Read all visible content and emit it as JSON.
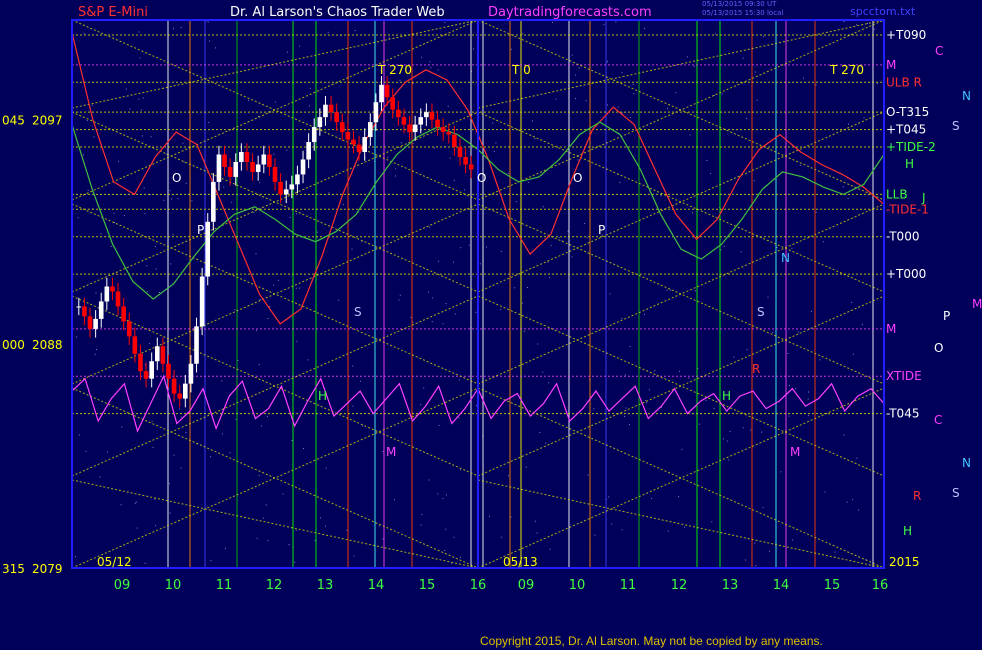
{
  "header": {
    "instrument": "S&P E-Mini",
    "author": "Dr. Al Larson's Chaos Trader Web",
    "site": "Daytradingforecasts.com",
    "timestamp_1": "05/13/2015 09:30 UT",
    "timestamp_2": "05/13/2015 15:30 local",
    "file": "spcctom.txt",
    "copyright": "Copyright 2015, Dr. Al Larson. May not be copied by any means."
  },
  "colors": {
    "background": "#00005a",
    "frame": "#2020ff",
    "price_up": "#ffffff",
    "price_down": "#ff0000",
    "xtide": "#ff40ff",
    "tide": "#40c040",
    "grid_yellow": "#e8e800",
    "axis_label": "#40ff40"
  },
  "chart_data": {
    "type": "line",
    "ylim": [
      2079,
      2101
    ],
    "y_left_labels": [
      {
        "angle": "045",
        "price": "2097",
        "value": 2097
      },
      {
        "angle": "000",
        "price": "2088",
        "value": 2088
      },
      {
        "angle": "315",
        "price": "2079",
        "value": 2079
      }
    ],
    "date_labels": [
      "05/12",
      "05/13"
    ],
    "year_label": "2015",
    "x_ticks": [
      "09",
      "10",
      "11",
      "12",
      "13",
      "14",
      "15",
      "16",
      "09",
      "10",
      "11",
      "12",
      "13",
      "14",
      "15",
      "16"
    ],
    "top_labels": [
      "T  270",
      "T  0",
      "T  270"
    ],
    "right_labels": [
      {
        "text": "+T090",
        "value": 2100.4,
        "color": "#ffffff"
      },
      {
        "text": "M",
        "value": 2099.2,
        "color": "#ff40ff"
      },
      {
        "text": "ULB R",
        "value": 2098.5,
        "color": "#ff3030"
      },
      {
        "text": "O-T315",
        "value": 2097.3,
        "color": "#ffffff"
      },
      {
        "text": "+T045",
        "value": 2096.6,
        "color": "#ffffff"
      },
      {
        "text": "+TIDE-2",
        "value": 2095.9,
        "color": "#40ff40"
      },
      {
        "text": "LLB",
        "value": 2094.0,
        "color": "#40ff40"
      },
      {
        "text": "-TIDE-1",
        "value": 2093.4,
        "color": "#ff3030"
      },
      {
        "text": "-T000",
        "value": 2092.3,
        "color": "#ffffff"
      },
      {
        "text": "+T000",
        "value": 2090.8,
        "color": "#ffffff"
      },
      {
        "text": "M",
        "value": 2088.6,
        "color": "#ff40ff"
      },
      {
        "text": "XTIDE",
        "value": 2086.7,
        "color": "#ff40ff"
      },
      {
        "text": "-T045",
        "value": 2085.2,
        "color": "#ffffff"
      }
    ],
    "planet_labels": [
      {
        "text": "C",
        "x": 935,
        "y": 55,
        "color": "#ff40ff"
      },
      {
        "text": "N",
        "x": 962,
        "y": 100,
        "color": "#40c0ff"
      },
      {
        "text": "S",
        "x": 952,
        "y": 130,
        "color": "#c0c0ff"
      },
      {
        "text": "H",
        "x": 905,
        "y": 168,
        "color": "#40ff40"
      },
      {
        "text": "J",
        "x": 922,
        "y": 202,
        "color": "#40ff40"
      },
      {
        "text": "M",
        "x": 972,
        "y": 308,
        "color": "#ff40ff"
      },
      {
        "text": "P",
        "x": 943,
        "y": 320,
        "color": "#ffffff"
      },
      {
        "text": "O",
        "x": 934,
        "y": 352,
        "color": "#ffffff"
      },
      {
        "text": "C",
        "x": 934,
        "y": 424,
        "color": "#ff40ff"
      },
      {
        "text": "N",
        "x": 962,
        "y": 467,
        "color": "#40c0ff"
      },
      {
        "text": "S",
        "x": 952,
        "y": 497,
        "color": "#c0c0ff"
      },
      {
        "text": "R",
        "x": 913,
        "y": 500,
        "color": "#ff3030"
      },
      {
        "text": "H",
        "x": 903,
        "y": 535,
        "color": "#40ff40"
      }
    ],
    "in_chart_labels": [
      {
        "text": "O",
        "x": 172,
        "y": 182,
        "color": "#ffffff"
      },
      {
        "text": "P",
        "x": 197,
        "y": 234,
        "color": "#ffffff"
      },
      {
        "text": "O",
        "x": 477,
        "y": 182,
        "color": "#ffffff"
      },
      {
        "text": "O",
        "x": 573,
        "y": 182,
        "color": "#ffffff"
      },
      {
        "text": "P",
        "x": 598,
        "y": 234,
        "color": "#ffffff"
      },
      {
        "text": "S",
        "x": 354,
        "y": 316,
        "color": "#c0c0ff"
      },
      {
        "text": "S",
        "x": 757,
        "y": 316,
        "color": "#c0c0ff"
      },
      {
        "text": "H",
        "x": 318,
        "y": 400,
        "color": "#40ff40"
      },
      {
        "text": "H",
        "x": 722,
        "y": 400,
        "color": "#40ff40"
      },
      {
        "text": "M",
        "x": 386,
        "y": 456,
        "color": "#ff40ff"
      },
      {
        "text": "M",
        "x": 790,
        "y": 456,
        "color": "#ff40ff"
      },
      {
        "text": "N",
        "x": 781,
        "y": 262,
        "color": "#40c0ff"
      },
      {
        "text": "R",
        "x": 752,
        "y": 373,
        "color": "#ff3030"
      }
    ],
    "vertical_lines": [
      {
        "x": 168,
        "color": "#ffffff"
      },
      {
        "x": 190,
        "color": "#ff8000"
      },
      {
        "x": 205,
        "color": "#4040ff"
      },
      {
        "x": 237,
        "color": "#00c000"
      },
      {
        "x": 293,
        "color": "#00ff00"
      },
      {
        "x": 316,
        "color": "#00ff00"
      },
      {
        "x": 348,
        "color": "#ff4000"
      },
      {
        "x": 375,
        "color": "#40ffff"
      },
      {
        "x": 384,
        "color": "#ff40ff"
      },
      {
        "x": 412,
        "color": "#ff4000"
      },
      {
        "x": 471,
        "color": "#ffffff"
      },
      {
        "x": 483,
        "color": "#ffffff"
      },
      {
        "x": 510,
        "color": "#ff8000"
      },
      {
        "x": 521,
        "color": "#ffff00"
      },
      {
        "x": 569,
        "color": "#ffffff"
      },
      {
        "x": 590,
        "color": "#ff8000"
      },
      {
        "x": 606,
        "color": "#4040ff"
      },
      {
        "x": 639,
        "color": "#00c000"
      },
      {
        "x": 697,
        "color": "#00ff00"
      },
      {
        "x": 720,
        "color": "#00ff00"
      },
      {
        "x": 752,
        "color": "#ff4000"
      },
      {
        "x": 776,
        "color": "#40ffff"
      },
      {
        "x": 786,
        "color": "#ff40ff"
      },
      {
        "x": 815,
        "color": "#ff4000"
      },
      {
        "x": 873,
        "color": "#ffffff"
      }
    ],
    "candles_day1": [
      2089.5,
      2089.1,
      2088.6,
      2089.0,
      2089.7,
      2090.3,
      2090.1,
      2089.5,
      2088.9,
      2088.3,
      2087.6,
      2086.9,
      2086.6,
      2087.3,
      2087.9,
      2087.2,
      2086.6,
      2086.0,
      2085.8,
      2086.4,
      2087.2,
      2088.7,
      2090.7,
      2092.9,
      2094.5,
      2095.6,
      2095.1,
      2094.7,
      2095.3,
      2095.7,
      2095.3,
      2094.9,
      2095.2,
      2095.6,
      2095.1,
      2094.5,
      2094.0,
      2094.2,
      2094.4,
      2094.8,
      2095.4,
      2096.1,
      2096.7,
      2097.1,
      2097.6,
      2097.3,
      2096.9,
      2096.5,
      2096.2,
      2096.0,
      2095.7,
      2096.3,
      2096.9,
      2097.7,
      2098.4,
      2097.9,
      2097.4,
      2097.1,
      2096.8,
      2096.5,
      2096.8,
      2097.1,
      2097.3,
      2097.0,
      2096.7,
      2096.5,
      2096.4,
      2095.9,
      2095.5,
      2095.2,
      2095.0
    ],
    "series": [
      {
        "name": "XTIDE",
        "color": "#ff40ff",
        "values": [
          2086.1,
          2086.6,
          2084.9,
          2085.8,
          2086.4,
          2084.5,
          2085.6,
          2086.7,
          2084.8,
          2085.3,
          2086.2,
          2084.6,
          2085.9,
          2086.5,
          2085.0,
          2085.4,
          2086.3,
          2084.7,
          2085.7,
          2086.6,
          2085.1,
          2085.6,
          2086.1,
          2085.2,
          2085.8,
          2086.4,
          2084.9,
          2085.5,
          2086.3,
          2084.8,
          2085.4,
          2086.2,
          2085.0,
          2085.7,
          2086.0,
          2085.1,
          2085.6,
          2086.4,
          2084.9,
          2085.4,
          2086.1,
          2085.3,
          2085.8,
          2086.3,
          2085.0,
          2085.5,
          2086.2,
          2085.2,
          2085.7,
          2086.0,
          2085.3,
          2085.9,
          2086.1,
          2085.4,
          2085.7,
          2086.2,
          2085.5,
          2085.8,
          2086.4,
          2085.3,
          2085.9,
          2086.2,
          2085.6
        ]
      },
      {
        "name": "TIDE-1",
        "color": "#ff3030",
        "values": [
          2100.5,
          2097.0,
          2094.5,
          2094.0,
          2095.5,
          2096.5,
          2096.0,
          2094.0,
          2092.0,
          2090.0,
          2088.8,
          2089.4,
          2091.5,
          2094.0,
          2096.0,
          2097.5,
          2098.5,
          2099.0,
          2098.6,
          2097.4,
          2095.4,
          2093.0,
          2091.6,
          2092.4,
          2094.6,
          2096.6,
          2097.5,
          2096.8,
          2095.0,
          2093.2,
          2092.2,
          2093.0,
          2094.6,
          2095.8,
          2096.4,
          2095.7,
          2095.2,
          2094.8,
          2094.3,
          2093.6
        ]
      },
      {
        "name": "TIDE-2",
        "color": "#40c040",
        "values": [
          2096.8,
          2094.2,
          2092.0,
          2090.5,
          2089.8,
          2090.4,
          2091.5,
          2092.5,
          2093.2,
          2093.5,
          2093.0,
          2092.4,
          2092.1,
          2092.5,
          2093.2,
          2094.5,
          2095.6,
          2096.3,
          2096.7,
          2096.4,
          2095.8,
          2095.0,
          2094.5,
          2094.7,
          2095.4,
          2096.4,
          2096.9,
          2096.4,
          2095.0,
          2093.2,
          2091.8,
          2091.4,
          2092.0,
          2093.0,
          2094.2,
          2094.9,
          2094.7,
          2094.3,
          2094.0,
          2094.4,
          2095.6
        ]
      }
    ]
  }
}
